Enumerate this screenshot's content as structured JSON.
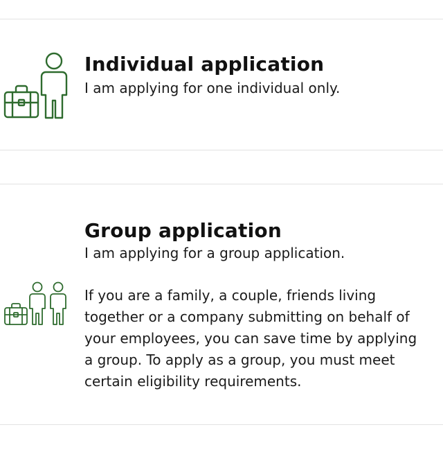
{
  "options": [
    {
      "title": "Individual application",
      "description": "I am applying for one individual only.",
      "icon": "person-with-luggage-icon"
    },
    {
      "title": "Group application",
      "description": "I am applying for a group application.",
      "details": [
        "If you are a family, a couple, friends living",
        "together or a company submitting on behalf of",
        "your employees, you can save time by applying",
        "a group. To apply as a group, you must meet",
        "certain eligibility requirements."
      ],
      "icon": "group-with-luggage-icon"
    }
  ],
  "colors": {
    "icon": "#2e6b2e",
    "divider": "#e2e2e2",
    "text": "#111111"
  }
}
